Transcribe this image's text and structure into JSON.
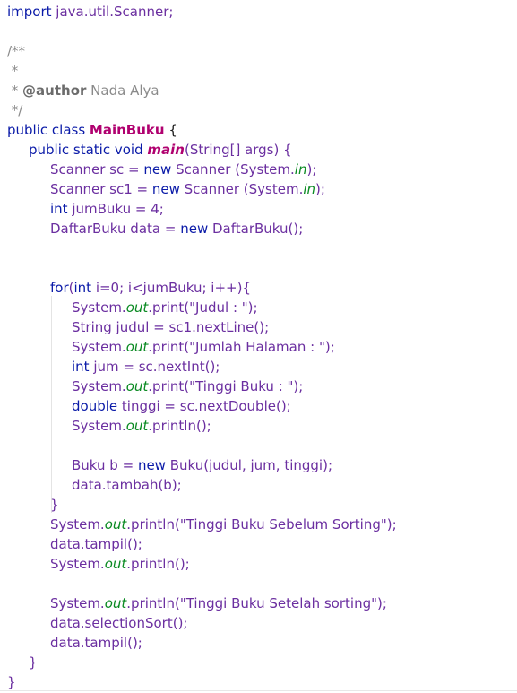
{
  "editor": {
    "l1_import": "import",
    "l1_pkg": " java.util.Scanner;",
    "l3": "/**",
    "l4": " *",
    "l5_pre": " * ",
    "l5_tag": "@author",
    "l5_name": " Nada Alya",
    "l6": " */",
    "l7_kw": "public class",
    "l7_sp": " ",
    "l7_cls": "MainBuku",
    "l7_brace": " {",
    "l8_kw": "public static void",
    "l8_sp": " ",
    "l8_main": "main",
    "l8_args": "(String[] args) {",
    "l9_a": "Scanner sc = ",
    "l9_new": "new",
    "l9_b": " Scanner (System.",
    "l9_in": "in",
    "l9_c": ");",
    "l10_a": "Scanner sc1 = ",
    "l10_new": "new",
    "l10_b": " Scanner (System.",
    "l10_in": "in",
    "l10_c": ");",
    "l11_int": "int",
    "l11_rest": " jumBuku = 4;",
    "l12_a": "DaftarBuku data = ",
    "l12_new": "new",
    "l12_b": " DaftarBuku();",
    "l15_for": "for",
    "l15_p": "(",
    "l15_int": "int",
    "l15_rest": " i=0; i<jumBuku; i++){",
    "l16_a": "System.",
    "l16_out": "out",
    "l16_b": ".print(\"Judul : \");",
    "l17": "String judul = sc1.nextLine();",
    "l18_a": "System.",
    "l18_out": "out",
    "l18_b": ".print(\"Jumlah Halaman : \");",
    "l19_int": "int",
    "l19_rest": " jum = sc.nextInt();",
    "l20_a": "System.",
    "l20_out": "out",
    "l20_b": ".print(\"Tinggi Buku : \");",
    "l21_double": "double",
    "l21_rest": " tinggi = sc.nextDouble();",
    "l22_a": "System.",
    "l22_out": "out",
    "l22_b": ".println();",
    "l24_a": "Buku b = ",
    "l24_new": "new",
    "l24_b": " Buku(judul, jum, tinggi);",
    "l25": "data.tambah(b);",
    "l26": "}",
    "l27_a": "System.",
    "l27_out": "out",
    "l27_b": ".println(\"Tinggi Buku Sebelum Sorting\");",
    "l28": "data.tampil();",
    "l29_a": "System.",
    "l29_out": "out",
    "l29_b": ".println();",
    "l31_a": "System.",
    "l31_out": "out",
    "l31_b": ".println(\"Tinggi Buku Setelah sorting\");",
    "l32": "data.selectionSort();",
    "l33": "data.tampil();",
    "l34": "}",
    "l35": "}"
  }
}
